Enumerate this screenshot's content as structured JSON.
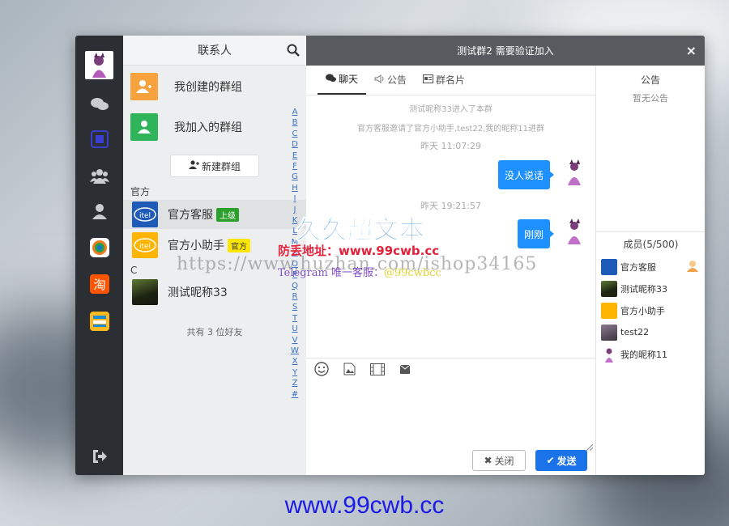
{
  "contacts_panel": {
    "title": "联系人",
    "my_created_groups": "我创建的群组",
    "my_joined_groups": "我加入的群组",
    "new_group_button": "新建群组",
    "section_official": "官方",
    "section_c": "C",
    "contacts": [
      {
        "name": "官方客服",
        "badge": "上级"
      },
      {
        "name": "官方小助手",
        "badge": "官方"
      },
      {
        "name": "测试昵称33"
      }
    ],
    "alphabet": [
      "A",
      "B",
      "C",
      "D",
      "E",
      "F",
      "G",
      "H",
      "I",
      "J",
      "K",
      "L",
      "M",
      "N",
      "O",
      "P",
      "Q",
      "R",
      "S",
      "T",
      "U",
      "V",
      "W",
      "X",
      "Y",
      "Z",
      "#"
    ],
    "total_friends": "共有 3 位好友"
  },
  "chat": {
    "title": "测试群2 需要验证加入",
    "close_label": "×",
    "tabs": [
      {
        "label": "聊天",
        "icon": "chat-icon"
      },
      {
        "label": "公告",
        "icon": "speaker-icon"
      },
      {
        "label": "群名片",
        "icon": "card-icon"
      }
    ],
    "system_messages": [
      "测试昵称33进入了本群",
      "官方客服邀请了官方小助手,test22,我的昵称11进群"
    ],
    "timestamps": [
      "昨天 11:07:29",
      "昨天 19:21:57"
    ],
    "messages": [
      "没人说话",
      "刚刚"
    ],
    "close_button": "关闭",
    "send_button": "发送"
  },
  "side": {
    "notice_title": "公告",
    "notice_body": "暂无公告",
    "members_title": "成员(5/500)",
    "members": [
      "官方客服",
      "测试昵称33",
      "官方小助手",
      "test22",
      "我的昵称11"
    ]
  },
  "watermarks": {
    "brand": "久久超文本",
    "anti_fake": "防丢地址：www.99cwb.cc",
    "url": "https://www.huzhan.com/ishop34165",
    "telegram_prefix": "Telegram",
    "telegram_mid": "唯一客服：",
    "telegram_handle": "@99cwbcc",
    "footer": "www.99cwb.cc"
  },
  "colors": {
    "accent_blue": "#1e90ff",
    "send_blue": "#1a73e8",
    "badge_green": "#2ca02c",
    "badge_yellow": "#ffe600",
    "dark_bar": "#2b2f33"
  }
}
